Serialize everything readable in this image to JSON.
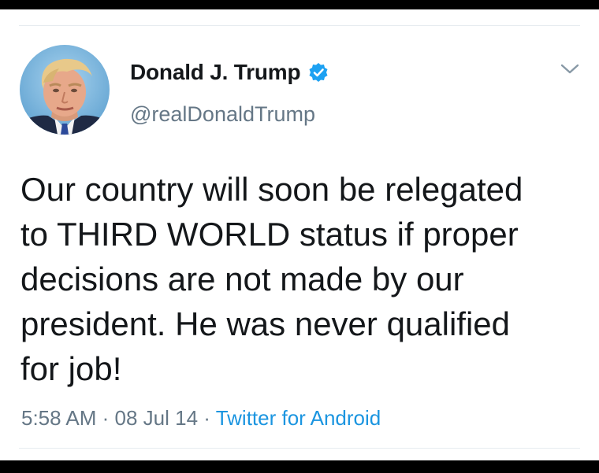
{
  "user": {
    "display_name": "Donald J. Trump",
    "handle": "@realDonaldTrump",
    "verified": true
  },
  "icons": {
    "verified": "verified-badge-icon",
    "caret": "chevron-down-icon"
  },
  "tweet": {
    "lines": [
      "Our country will soon be relegated",
      "to THIRD WORLD status if proper",
      "decisions are not made by our",
      "president. He was never qualified",
      "for job!"
    ],
    "time": "5:58 AM",
    "separator1": " · ",
    "date": "08 Jul 14",
    "separator2": " · ",
    "source": "Twitter for Android"
  },
  "colors": {
    "text": "#14171a",
    "secondary": "#657786",
    "link": "#1b95e0",
    "verified_blue": "#1da1f2"
  }
}
